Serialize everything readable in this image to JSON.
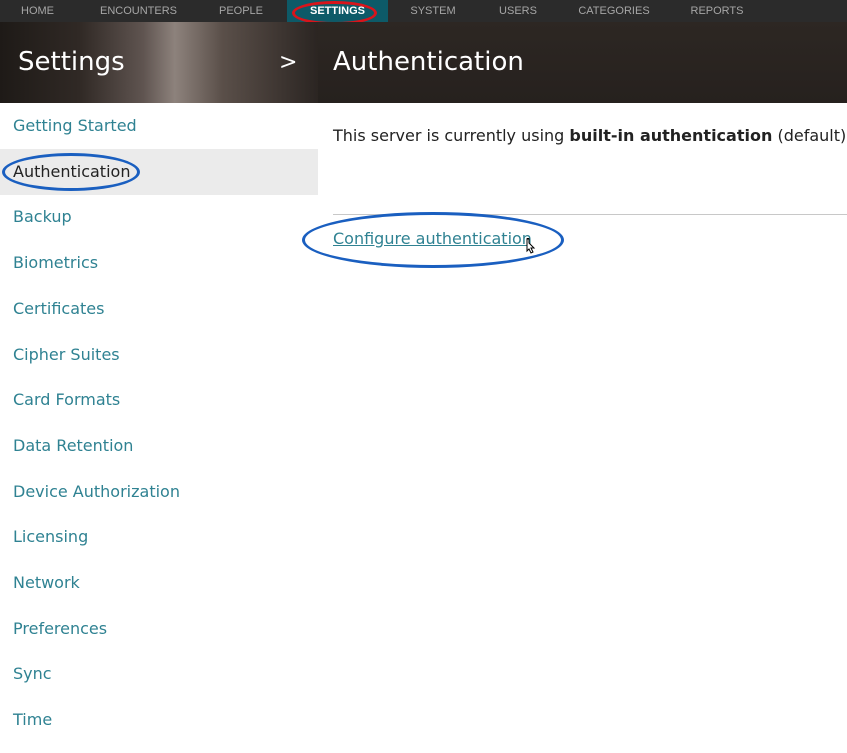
{
  "topnav": {
    "items": [
      {
        "label": "HOME"
      },
      {
        "label": "ENCOUNTERS"
      },
      {
        "label": "PEOPLE"
      },
      {
        "label": "SETTINGS",
        "active": true
      },
      {
        "label": "SYSTEM"
      },
      {
        "label": "USERS"
      },
      {
        "label": "CATEGORIES"
      },
      {
        "label": "REPORTS"
      }
    ]
  },
  "header": {
    "section_title": "Settings",
    "chevron": ">",
    "page_title": "Authentication"
  },
  "sidebar": {
    "items": [
      {
        "label": "Getting Started"
      },
      {
        "label": "Authentication",
        "selected": true
      },
      {
        "label": "Backup"
      },
      {
        "label": "Biometrics"
      },
      {
        "label": "Certificates"
      },
      {
        "label": "Cipher Suites"
      },
      {
        "label": "Card Formats"
      },
      {
        "label": "Data Retention"
      },
      {
        "label": "Device Authorization"
      },
      {
        "label": "Licensing"
      },
      {
        "label": "Network"
      },
      {
        "label": "Preferences"
      },
      {
        "label": "Sync"
      },
      {
        "label": "Time"
      }
    ]
  },
  "main": {
    "desc_prefix": "This server is currently using ",
    "desc_bold": "built-in authentication",
    "desc_suffix": " (default).",
    "configure_link": "Configure authentication"
  },
  "colors": {
    "nav_bg": "#2b2b2b",
    "nav_active": "#0d5a68",
    "link": "#2f8292",
    "annotation_red": "#d8141b",
    "annotation_blue": "#1a5fc0"
  }
}
